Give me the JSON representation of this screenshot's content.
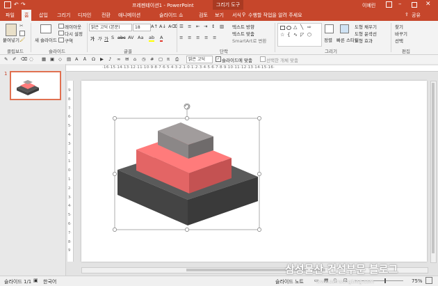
{
  "titlebar": {
    "doc_title": "프레젠테이션1 - PowerPoint",
    "context_label": "그리기 도구",
    "user": "이예린",
    "min_icon": "minimize-icon",
    "max_icon": "maximize-icon",
    "close_icon": "close-icon"
  },
  "tabs": [
    "파일",
    "홈",
    "삽입",
    "그리기",
    "디자인",
    "전환",
    "애니메이션",
    "슬라이드 쇼",
    "검토",
    "보기",
    "서식"
  ],
  "tell_me": "수행할 작업을 알려 주세요",
  "share": "공유",
  "ribbon": {
    "paste": "붙여넣기",
    "new_slide": "새 슬라이드",
    "layout": "레이아웃",
    "reset": "다시 설정",
    "section": "구역",
    "font_name": "맑은 고딕 (본문)",
    "font_size": "18",
    "text_direction": "텍스트 방향",
    "align_text": "텍스트 맞춤",
    "smartart": "SmartArt로 변환",
    "arrange": "정렬",
    "quick_styles": "빠른 스타일",
    "shape_fill": "도형 채우기",
    "shape_outline": "도형 윤곽선",
    "shape_effects": "도형 효과",
    "find": "찾기",
    "replace": "바꾸기",
    "select": "선택",
    "groups": {
      "clipboard": "클립보드",
      "slides": "슬라이드",
      "font": "글꼴",
      "paragraph": "단락",
      "drawing": "그리기",
      "editing": "편집"
    }
  },
  "toolbar2": {
    "font_name": "맑은 고딕",
    "fit_to_slide": "슬라이드에 맞춤",
    "selected_object": "선택한 개체 맞춤"
  },
  "ruler_h": "·16·15·14·13·12·11·10·9·8·7·6·5·4·3·2·1·0·1·2·3·4·5·6·7·8·9·10·11·12·13·14·15·16·",
  "ruler_v": "9·8·7·6·5·4·3·2·1·0·1·2·3·4·5·6·7·8·9",
  "thumbnail": {
    "number": "1"
  },
  "status": {
    "slide": "슬라이드 1/1",
    "language": "한국어",
    "notes": "슬라이드 노트",
    "zoom": "75%"
  },
  "shape": {
    "top_colors": [
      "#a19c9c",
      "#8b8787",
      "#6f6b6b"
    ],
    "mid_colors": [
      "#ff7b7b",
      "#e36565",
      "#c45252"
    ],
    "bottom_colors": [
      "#5a5a5a",
      "#444444",
      "#3a3a3a"
    ]
  },
  "watermark": "삼성물산 건설부문 블로그",
  "watermark_url": "www.samsungblog.com"
}
